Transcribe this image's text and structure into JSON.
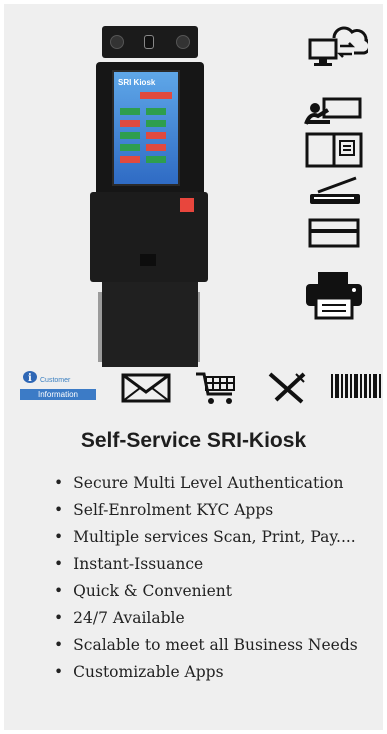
{
  "product": {
    "title": "Self-Service SRI-Kiosk",
    "screen_brand": "SRI Kiosk"
  },
  "customer_badge": {
    "top_text": "Customer",
    "bottom_text": "Information"
  },
  "features": [
    "Secure Multi Level Authentication",
    "Self-Enrolment KYC Apps",
    "Multiple services Scan, Print, Pay....",
    "Instant-Issuance",
    "Quick & Convenient",
    "24/7 Available",
    "Scalable to meet all Business Needs",
    "Customizable Apps"
  ],
  "right_icons": [
    "cloud-computer-icon",
    "presenter-board-icon",
    "book-icon",
    "scanner-icon",
    "card-reader-icon",
    "printer-icon"
  ],
  "bottom_icons": [
    "customer-information-icon",
    "envelope-icon",
    "shopping-cart-icon",
    "fork-knife-icon",
    "barcode-icon"
  ],
  "colors": {
    "background": "#efefef",
    "accent_blue": "#3c7bc6",
    "card_slot_red": "#e8463d"
  }
}
